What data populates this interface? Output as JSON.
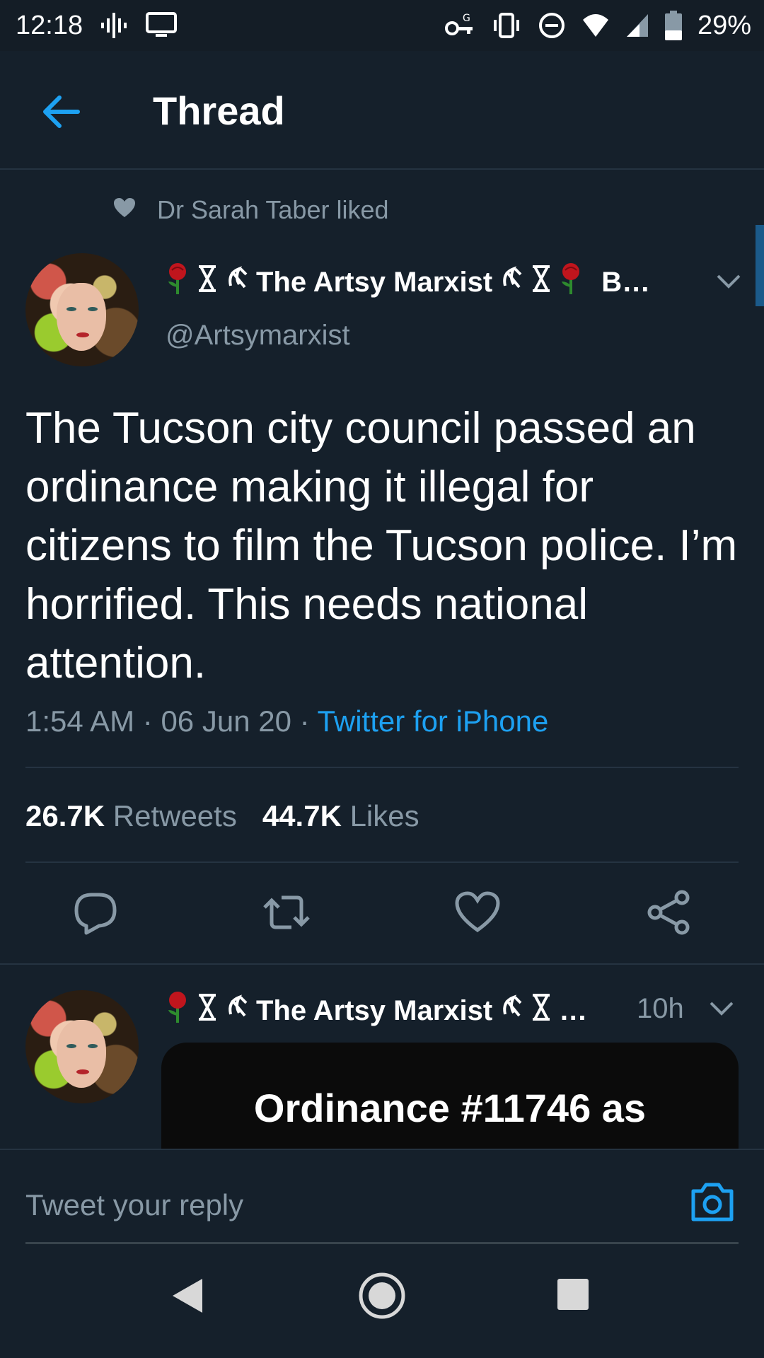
{
  "status_bar": {
    "time": "12:18",
    "battery_percent": "29%",
    "icons_left": [
      "podcast-icon",
      "cast-icon"
    ],
    "icons_right": [
      "vpn-key-icon",
      "vibrate-icon",
      "dnd-icon",
      "wifi-icon",
      "signal-icon",
      "battery-icon"
    ]
  },
  "header": {
    "title": "Thread"
  },
  "social_context": {
    "text": "Dr Sarah Taber liked"
  },
  "main_tweet": {
    "display_name": "The Artsy Marxist",
    "name_suffix": "B…",
    "handle": "@Artsymarxist",
    "text": "The Tucson city council passed an ordinance making it illegal for citizens to film the Tucson police. I’m horrified. This needs national attention.",
    "time": "1:54 AM",
    "date": "06 Jun 20",
    "separator": "·",
    "source": "Twitter for iPhone",
    "retweets_count": "26.7K",
    "retweets_label": "Retweets",
    "likes_count": "44.7K",
    "likes_label": "Likes"
  },
  "reply_tweet": {
    "display_name": "The Artsy Marxist",
    "truncation": "…",
    "time_ago": "10h",
    "media_text": "Ordinance #11746 as"
  },
  "reply_bar": {
    "placeholder": "Tweet your reply"
  },
  "colors": {
    "background": "#15202b",
    "accent": "#1da1f2",
    "secondary_text": "#8899a6",
    "divider": "#253341"
  }
}
